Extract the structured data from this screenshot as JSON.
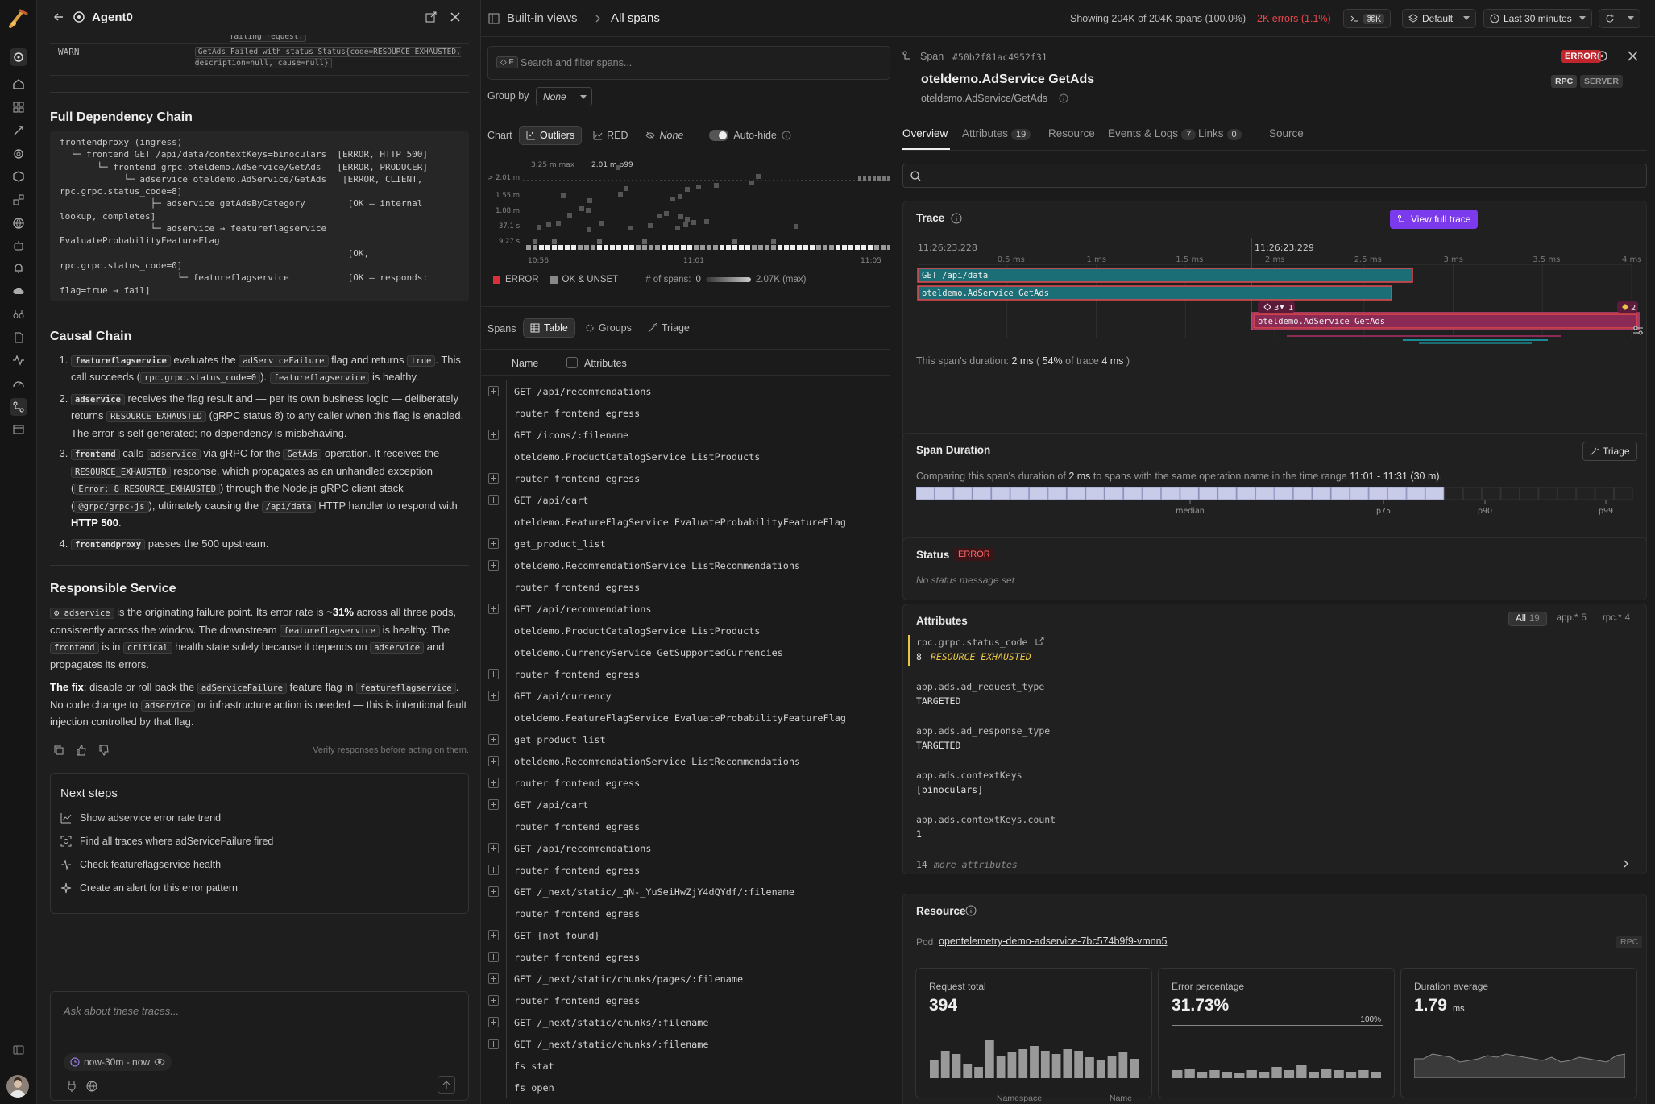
{
  "agent": {
    "title": "Agent0",
    "log_rows": [
      {
        "level": "WARN",
        "message": "adServiceFailure fail feature flag enabled, failing request."
      },
      {
        "level": "WARN",
        "message": "GetAds Failed with status Status{code=RESOURCE_EXHAUSTED, description=null, cause=null}"
      }
    ],
    "dependency_title": "Full Dependency Chain",
    "dependency_chain": "frontendproxy (ingress)\n  └─ frontend GET /api/data?contextKeys=binoculars  [ERROR, HTTP 500]\n       └─ frontend grpc.oteldemo.AdService/GetAds   [ERROR, PRODUCER]\n            └─ adservice oteldemo.AdService/GetAds   [ERROR, CLIENT, rpc.grpc.status_code=8]\n                 ├─ adservice getAdsByCategory        [OK — internal lookup, completes]\n                 └─ adservice → featureflagservice EvaluateProbabilityFeatureFlag\n                                                      [OK, rpc.grpc.status_code=0]\n                      └─ featureflagservice           [OK — responds: flag=true → fail]",
    "causal_title": "Causal Chain",
    "causal": [
      {
        "parts": [
          [
            "code-b",
            "featureflagservice"
          ],
          [
            "t",
            " evaluates the "
          ],
          [
            "code",
            "adServiceFailure"
          ],
          [
            "t",
            " flag and returns "
          ],
          [
            "code",
            "true"
          ],
          [
            "t",
            ". This call succeeds ("
          ],
          [
            "code",
            "rpc.grpc.status_code=0"
          ],
          [
            "t",
            "). "
          ],
          [
            "code",
            "featureflagservice"
          ],
          [
            "t",
            " is healthy."
          ]
        ]
      },
      {
        "parts": [
          [
            "code-b",
            "adservice"
          ],
          [
            "t",
            " receives the flag result and — per its own business logic — deliberately returns "
          ],
          [
            "code",
            "RESOURCE_EXHAUSTED"
          ],
          [
            "t",
            " (gRPC status 8) to any caller when this flag is enabled. The error is self-generated; no dependency is misbehaving."
          ]
        ]
      },
      {
        "parts": [
          [
            "code-b",
            "frontend"
          ],
          [
            "t",
            " calls "
          ],
          [
            "code",
            "adservice"
          ],
          [
            "t",
            " via gRPC for the "
          ],
          [
            "code",
            "GetAds"
          ],
          [
            "t",
            " operation. It receives the "
          ],
          [
            "code",
            "RESOURCE_EXHAUSTED"
          ],
          [
            "t",
            " response, which propagates as an unhandled exception ("
          ],
          [
            "code",
            "Error: 8 RESOURCE_EXHAUSTED"
          ],
          [
            "t",
            ") through the Node.js gRPC client stack ("
          ],
          [
            "code",
            "@grpc/grpc-js"
          ],
          [
            "t",
            "), ultimately causing the "
          ],
          [
            "code",
            "/api/data"
          ],
          [
            "t",
            " HTTP handler to respond with "
          ],
          [
            "b",
            "HTTP 500"
          ],
          [
            "t",
            "."
          ]
        ]
      },
      {
        "parts": [
          [
            "code-b",
            "frontendproxy"
          ],
          [
            "t",
            " passes the 500 upstream."
          ]
        ]
      }
    ],
    "responsible_title": "Responsible Service",
    "responsible_p1": [
      [
        "code",
        "⚙ adservice"
      ],
      [
        "t",
        " is the originating failure point. Its error rate is "
      ],
      [
        "b",
        "~31%"
      ],
      [
        "t",
        " across all three pods, consistently across the window. The downstream "
      ],
      [
        "code",
        "featureflagservice"
      ],
      [
        "t",
        " is healthy. The "
      ],
      [
        "code",
        "frontend"
      ],
      [
        "t",
        " is in "
      ],
      [
        "code",
        "critical"
      ],
      [
        "t",
        " health state solely because it depends on "
      ],
      [
        "code",
        "adservice"
      ],
      [
        "t",
        " and propagates its errors."
      ]
    ],
    "responsible_p2": [
      [
        "b",
        "The fix"
      ],
      [
        "t",
        ": disable or roll back the "
      ],
      [
        "code",
        "adServiceFailure"
      ],
      [
        "t",
        " feature flag in "
      ],
      [
        "code",
        "featureflagservice"
      ],
      [
        "t",
        ". No code change to "
      ],
      [
        "code",
        "adservice"
      ],
      [
        "t",
        " or infrastructure action is needed — this is intentional fault injection controlled by that flag."
      ]
    ],
    "verify_note": "Verify responses before acting on them.",
    "next_steps_title": "Next steps",
    "next_steps": [
      {
        "icon": "chart-line-icon",
        "label": "Show adservice error rate trend"
      },
      {
        "icon": "scan-icon",
        "label": "Find all traces where adServiceFailure fired"
      },
      {
        "icon": "pulse-icon",
        "label": "Check featureflagservice health"
      },
      {
        "icon": "sparkle-icon",
        "label": "Create an alert for this error pattern"
      }
    ],
    "ask_placeholder": "Ask about these traces...",
    "time_chip": "now-30m - now"
  },
  "topbar": {
    "crumb_root": "Built-in views",
    "crumb_current": "All spans",
    "showing": "Showing 204K of 204K spans (100.0%)",
    "errors": "2K errors (1.1%)",
    "shortcut": "⌘K",
    "view": "Default",
    "time_range": "Last 30 minutes"
  },
  "spans_panel": {
    "search_key": "F",
    "search_placeholder": "Search and filter spans...",
    "group_by_label": "Group by",
    "group_by_value": "None",
    "chart_label": "Chart",
    "chart_modes": [
      "Outliers",
      "RED",
      "None"
    ],
    "autohide_label": "Auto-hide",
    "chart_max": "3.25 m max",
    "chart_p99": "2.01 m p99",
    "y_ticks": [
      "> 2.01 m",
      "1.55 m",
      "1.08 m",
      "37.1 s",
      "9.27 s"
    ],
    "x_ticks": [
      "10:56",
      "11:01",
      "11:05"
    ],
    "legend_error": "ERROR",
    "legend_ok": "OK & UNSET",
    "spans_count_label": "# of spans:",
    "spans_count_min": "0",
    "spans_count_max": "2.07K (max)",
    "spans_label": "Spans",
    "view_tabs": [
      "Table",
      "Groups",
      "Triage"
    ],
    "col_name": "Name",
    "col_attributes": "Attributes",
    "rows": [
      {
        "name": "GET /api/recommendations",
        "expand": true
      },
      {
        "name": "router frontend egress",
        "expand": false
      },
      {
        "name": "GET /icons/:filename",
        "expand": true
      },
      {
        "name": "oteldemo.ProductCatalogService ListProducts",
        "expand": false
      },
      {
        "name": "router frontend egress",
        "expand": true
      },
      {
        "name": "GET /api/cart",
        "expand": true
      },
      {
        "name": "oteldemo.FeatureFlagService EvaluateProbabilityFeatureFlag",
        "expand": false
      },
      {
        "name": "get_product_list",
        "expand": true
      },
      {
        "name": "oteldemo.RecommendationService ListRecommendations",
        "expand": true
      },
      {
        "name": "router frontend egress",
        "expand": false
      },
      {
        "name": "GET /api/recommendations",
        "expand": true
      },
      {
        "name": "oteldemo.ProductCatalogService ListProducts",
        "expand": false
      },
      {
        "name": "oteldemo.CurrencyService GetSupportedCurrencies",
        "expand": false
      },
      {
        "name": "router frontend egress",
        "expand": true
      },
      {
        "name": "GET /api/currency",
        "expand": true
      },
      {
        "name": "oteldemo.FeatureFlagService EvaluateProbabilityFeatureFlag",
        "expand": false
      },
      {
        "name": "get_product_list",
        "expand": true
      },
      {
        "name": "oteldemo.RecommendationService ListRecommendations",
        "expand": true
      },
      {
        "name": "router frontend egress",
        "expand": true
      },
      {
        "name": "GET /api/cart",
        "expand": true
      },
      {
        "name": "router frontend egress",
        "expand": false
      },
      {
        "name": "GET /api/recommendations",
        "expand": true
      },
      {
        "name": "router frontend egress",
        "expand": true
      },
      {
        "name": "GET /_next/static/_qN-_YuSeiHwZjY4dQYdf/:filename",
        "expand": true
      },
      {
        "name": "router frontend egress",
        "expand": false
      },
      {
        "name": "GET {not found}",
        "expand": true
      },
      {
        "name": "router frontend egress",
        "expand": true
      },
      {
        "name": "GET /_next/static/chunks/pages/:filename",
        "expand": true
      },
      {
        "name": "router frontend egress",
        "expand": true
      },
      {
        "name": "GET /_next/static/chunks/:filename",
        "expand": true
      },
      {
        "name": "GET /_next/static/chunks/:filename",
        "expand": true
      },
      {
        "name": "fs stat",
        "expand": false
      },
      {
        "name": "fs open",
        "expand": false
      }
    ]
  },
  "detail": {
    "span_label": "Span",
    "span_id": "#50b2f81ac4952f31",
    "status_badge": "ERROR",
    "title": "oteldemo.AdService GetAds",
    "subtitle": "oteldemo.AdService/GetAds",
    "tag_rpc": "RPC",
    "tag_server": "SERVER",
    "tabs": [
      {
        "label": "Overview",
        "count": null
      },
      {
        "label": "Attributes",
        "count": "19"
      },
      {
        "label": "Resource",
        "count": null
      },
      {
        "label": "Events & Logs",
        "count": "7"
      },
      {
        "label": "Links",
        "count": "0"
      },
      {
        "label": "Source",
        "count": null
      }
    ],
    "trace": {
      "title": "Trace",
      "view_full": "View full trace",
      "time_left": "11:26:23.228",
      "time_right": "11:26:23.229",
      "ticks": [
        "0.5 ms",
        "1 ms",
        "1.5 ms",
        "2 ms",
        "2.5 ms",
        "3 ms",
        "3.5 ms",
        "4 ms"
      ],
      "bars": [
        "GET /api/data",
        "oteldemo.AdService GetAds",
        "oteldemo.AdService GetAds"
      ],
      "marker_left": "3",
      "marker_mid": "1",
      "marker_right": "2",
      "duration_prefix": "This span's duration:",
      "duration": "2 ms",
      "pct": "54%",
      "of_trace": "of trace",
      "trace_total": "4 ms"
    },
    "span_duration": {
      "title": "Span Duration",
      "triage": "Triage",
      "desc_prefix": "Comparing this span's duration of",
      "desc_value": "2 ms",
      "desc_mid": "to spans with the same operation name in the time range",
      "desc_range": "11:01 - 11:31 (30 m).",
      "labels": [
        "median",
        "p75",
        "p90",
        "p99"
      ]
    },
    "status": {
      "title": "Status",
      "badge": "ERROR",
      "message": "No status message set"
    },
    "attributes": {
      "title": "Attributes",
      "filters": [
        {
          "label": "All",
          "count": "19"
        },
        {
          "label": "app.*",
          "count": "5"
        },
        {
          "label": "rpc.*",
          "count": "4"
        }
      ],
      "items": [
        {
          "key": "rpc.grpc.status_code",
          "value_num": "8",
          "value": "RESOURCE_EXHAUSTED"
        },
        {
          "key": "app.ads.ad_request_type",
          "value": "TARGETED"
        },
        {
          "key": "app.ads.ad_response_type",
          "value": "TARGETED"
        },
        {
          "key": "app.ads.contextKeys",
          "value": "[binoculars]"
        },
        {
          "key": "app.ads.contextKeys.count",
          "value": "1"
        }
      ],
      "more_count": "14",
      "more_label": "more attributes"
    },
    "resource": {
      "title": "Resource",
      "pod_label": "Pod",
      "pod": "opentelemetry-demo-adservice-7bc574b9f9-vmnn5",
      "tag": "RPC",
      "metrics": [
        {
          "label": "Request total",
          "value": "394",
          "unit": ""
        },
        {
          "label": "Error percentage",
          "value": "31.73%",
          "unit": "",
          "ref": "100%"
        },
        {
          "label": "Duration average",
          "value": "1.79",
          "unit": "ms"
        }
      ],
      "col_namespace": "Namespace",
      "col_name": "Name"
    }
  },
  "colors": {
    "error": "#d9303a",
    "accent": "#7c3aed",
    "bar_teal": "#1c6e76",
    "bar_pink": "#8a2a55",
    "warn": "#e8c547"
  }
}
